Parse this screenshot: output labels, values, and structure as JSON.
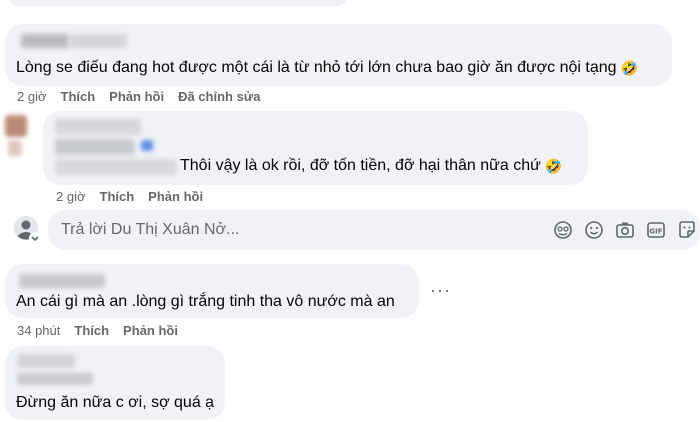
{
  "comments": [
    {
      "text": "Lòng se điếu đang hot được một cái là từ nhỏ tới lớn chưa bao giờ ăn được nội tạng",
      "emoji": "🤣",
      "time": "2 giờ",
      "like_label": "Thích",
      "reply_label": "Phản hồi",
      "edited_label": "Đã chỉnh sửa"
    },
    {
      "text": "Thôi vậy là ok rồi, đỡ tốn tiền, đỡ hại thân nữa chứ",
      "emoji": "🤣",
      "time": "2 giờ",
      "like_label": "Thích",
      "reply_label": "Phản hồi"
    },
    {
      "text": "An cái gì mà an .lòng gì trắng tinh tha vô nước mà an",
      "time": "34 phút",
      "like_label": "Thích",
      "reply_label": "Phản hồi",
      "more_label": "···"
    },
    {
      "text": "Đừng ăn nữa c ơi, sợ quá ạ"
    }
  ],
  "reply_box": {
    "placeholder": "Trả lời Du Thị Xuân Nở...",
    "icons": [
      "avatar-icon",
      "sticker-icon",
      "emoji-icon",
      "camera-icon",
      "gif-icon",
      "sticker-pack-icon"
    ]
  },
  "colors": {
    "bubble": "#f0f2f5",
    "meta_text": "#65676b",
    "text": "#050505"
  }
}
